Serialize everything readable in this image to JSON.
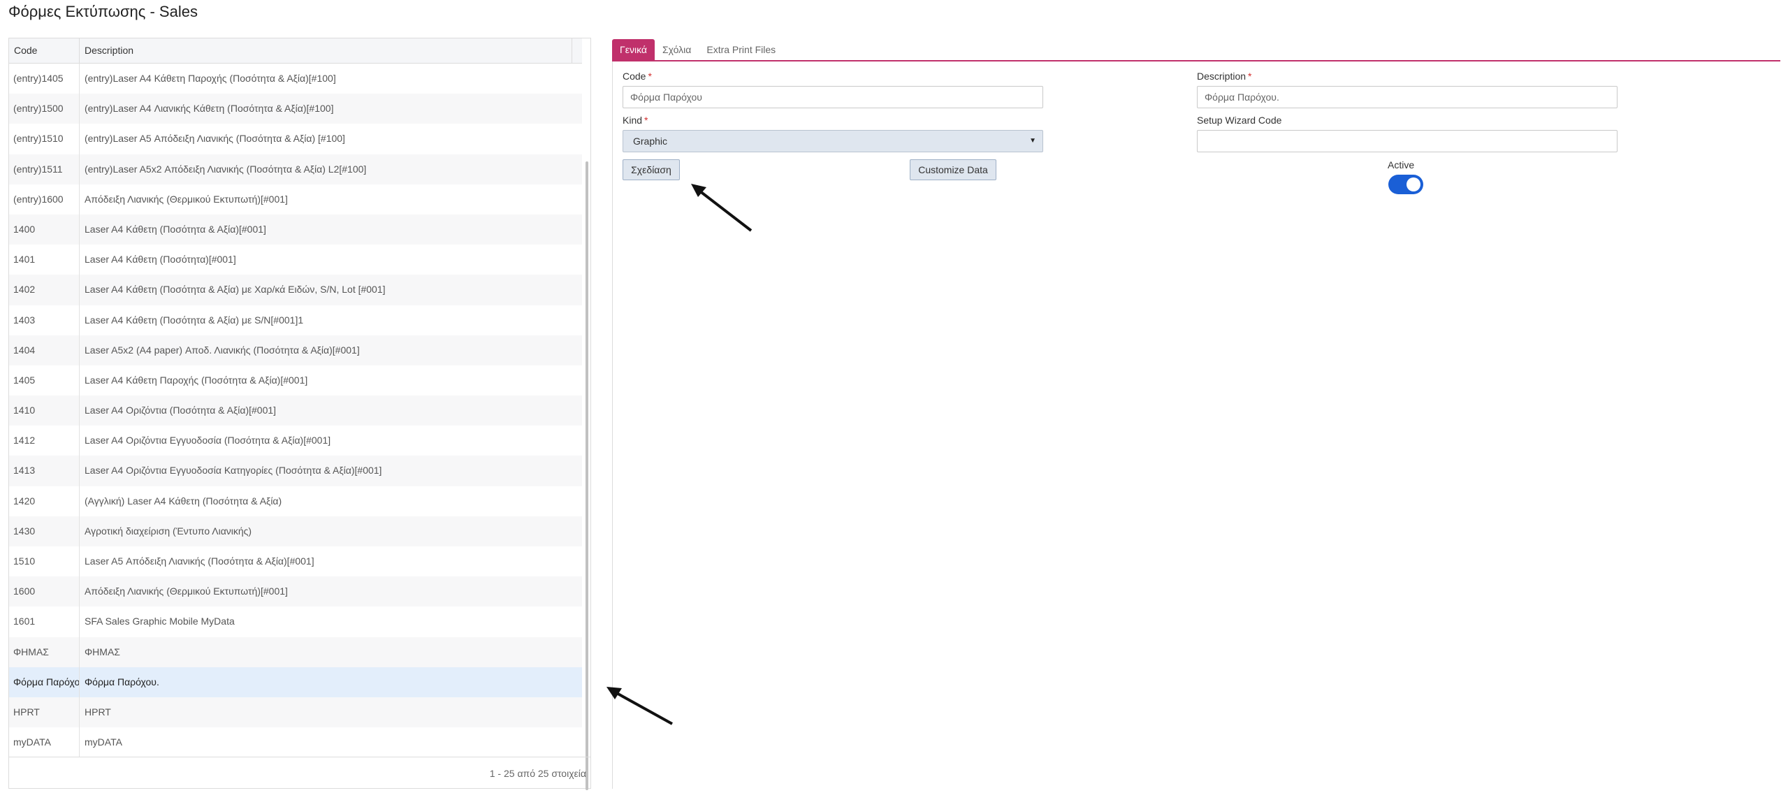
{
  "page": {
    "title": "Φόρμες Εκτύπωσης - Sales"
  },
  "grid": {
    "columns": [
      "Code",
      "Description"
    ],
    "rows": [
      {
        "code": "(entry)1405",
        "description": "(entry)Laser A4 Κάθετη Παροχής (Ποσότητα & Αξία)[#100]"
      },
      {
        "code": "(entry)1500",
        "description": "(entry)Laser A4 Λιανικής Κάθετη (Ποσότητα & Αξία)[#100]"
      },
      {
        "code": "(entry)1510",
        "description": "(entry)Laser A5 Απόδειξη Λιανικής (Ποσότητα & Αξία) [#100]"
      },
      {
        "code": "(entry)1511",
        "description": "(entry)Laser A5x2 Απόδειξη Λιανικής (Ποσότητα & Αξία) L2[#100]"
      },
      {
        "code": "(entry)1600",
        "description": "Απόδειξη Λιανικής (Θερμικού Εκτυπωτή)[#001]"
      },
      {
        "code": "1400",
        "description": "Laser A4 Κάθετη (Ποσότητα & Αξία)[#001]"
      },
      {
        "code": "1401",
        "description": "Laser A4 Κάθετη (Ποσότητα)[#001]"
      },
      {
        "code": "1402",
        "description": "Laser A4 Κάθετη (Ποσότητα & Αξία) με Χαρ/κά Ειδών, S/N, Lot [#001]"
      },
      {
        "code": "1403",
        "description": "Laser A4 Κάθετη (Ποσότητα & Αξία) με S/N[#001]1"
      },
      {
        "code": "1404",
        "description": "Laser A5x2 (A4 paper) Αποδ. Λιανικής (Ποσότητα & Αξία)[#001]"
      },
      {
        "code": "1405",
        "description": "Laser A4 Κάθετη Παροχής (Ποσότητα & Αξία)[#001]"
      },
      {
        "code": "1410",
        "description": "Laser A4 Οριζόντια (Ποσότητα & Αξία)[#001]"
      },
      {
        "code": "1412",
        "description": "Laser A4 Οριζόντια Εγγυοδοσία (Ποσότητα & Αξία)[#001]"
      },
      {
        "code": "1413",
        "description": "Laser A4 Οριζόντια Εγγυοδοσία Κατηγορίες (Ποσότητα & Αξία)[#001]"
      },
      {
        "code": "1420",
        "description": "(Αγγλική) Laser A4 Κάθετη (Ποσότητα & Αξία)"
      },
      {
        "code": "1430",
        "description": "Αγροτική διαχείριση (Έντυπο Λιανικής)"
      },
      {
        "code": "1510",
        "description": "Laser A5 Απόδειξη Λιανικής (Ποσότητα & Αξία)[#001]"
      },
      {
        "code": "1600",
        "description": "Απόδειξη Λιανικής (Θερμικού Εκτυπωτή)[#001]"
      },
      {
        "code": "1601",
        "description": "SFA Sales Graphic Mobile MyData"
      },
      {
        "code": "ΦΗΜΑΣ",
        "description": "ΦΗΜΑΣ"
      },
      {
        "code": "Φόρμα Παρόχου",
        "description": "Φόρμα Παρόχου."
      },
      {
        "code": "HPRT",
        "description": "HPRT"
      },
      {
        "code": "myDATA",
        "description": "myDATA"
      }
    ],
    "selected_index": 20,
    "footer": "1 - 25 από 25 στοιχεία"
  },
  "tabs": [
    {
      "label": "Γενικά",
      "active": true
    },
    {
      "label": "Σχόλια",
      "active": false
    },
    {
      "label": "Extra Print Files",
      "active": false
    }
  ],
  "form": {
    "code_label": "Code",
    "code_value": "Φόρμα Παρόχου",
    "description_label": "Description",
    "description_value": "Φόρμα Παρόχου.",
    "kind_label": "Kind",
    "kind_value": "Graphic",
    "setup_wizard_label": "Setup Wizard Code",
    "setup_wizard_value": "",
    "required_mark": "*",
    "design_button": "Σχεδίαση",
    "customize_button": "Customize Data",
    "active_label": "Active",
    "active_value": true
  },
  "colors": {
    "accent": "#c0306b",
    "toggle_on": "#1a5fd6",
    "selected_row": "#e3eefb"
  },
  "icons": {
    "select_caret": "▼"
  }
}
